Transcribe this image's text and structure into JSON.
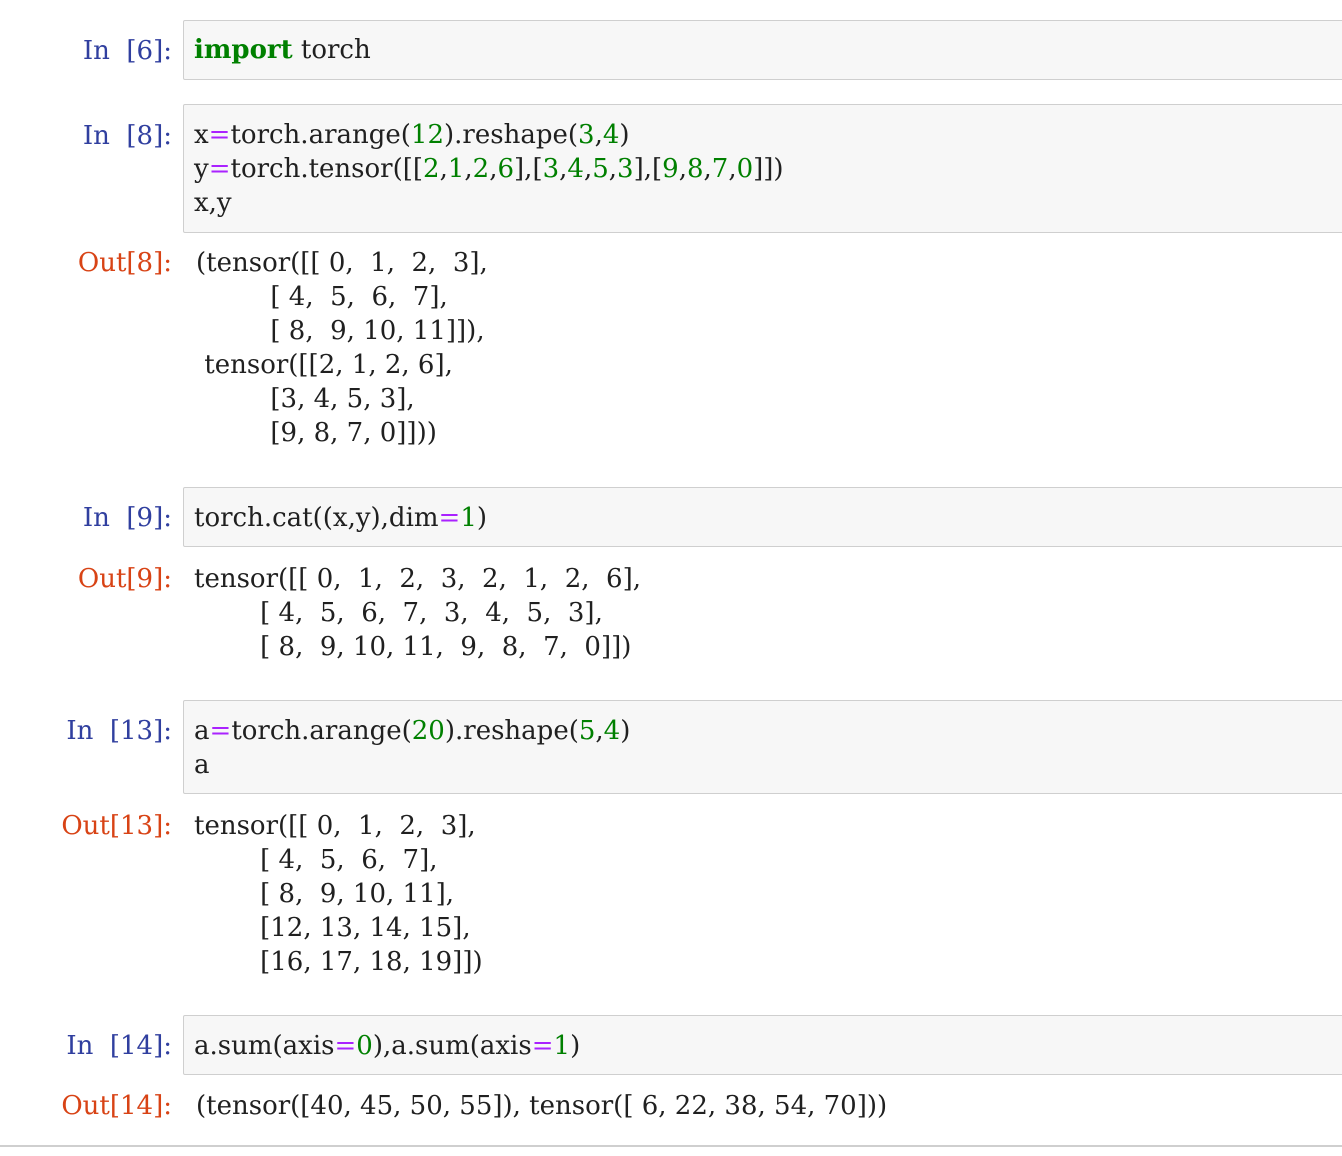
{
  "cells": [
    {
      "in_prompt": "In  [6]:",
      "code_lines": [
        [
          {
            "t": "import",
            "c": "kw"
          },
          {
            "t": " torch",
            "c": ""
          }
        ]
      ]
    },
    {
      "in_prompt": "In  [8]:",
      "code_lines": [
        [
          {
            "t": "x",
            "c": ""
          },
          {
            "t": "=",
            "c": "op"
          },
          {
            "t": "torch.arange(",
            "c": ""
          },
          {
            "t": "12",
            "c": "num"
          },
          {
            "t": ").reshape(",
            "c": ""
          },
          {
            "t": "3",
            "c": "num"
          },
          {
            "t": ",",
            "c": ""
          },
          {
            "t": "4",
            "c": "num"
          },
          {
            "t": ")",
            "c": ""
          }
        ],
        [
          {
            "t": "y",
            "c": ""
          },
          {
            "t": "=",
            "c": "op"
          },
          {
            "t": "torch.tensor([[",
            "c": ""
          },
          {
            "t": "2",
            "c": "num"
          },
          {
            "t": ",",
            "c": ""
          },
          {
            "t": "1",
            "c": "num"
          },
          {
            "t": ",",
            "c": ""
          },
          {
            "t": "2",
            "c": "num"
          },
          {
            "t": ",",
            "c": ""
          },
          {
            "t": "6",
            "c": "num"
          },
          {
            "t": "],[",
            "c": ""
          },
          {
            "t": "3",
            "c": "num"
          },
          {
            "t": ",",
            "c": ""
          },
          {
            "t": "4",
            "c": "num"
          },
          {
            "t": ",",
            "c": ""
          },
          {
            "t": "5",
            "c": "num"
          },
          {
            "t": ",",
            "c": ""
          },
          {
            "t": "3",
            "c": "num"
          },
          {
            "t": "],[",
            "c": ""
          },
          {
            "t": "9",
            "c": "num"
          },
          {
            "t": ",",
            "c": ""
          },
          {
            "t": "8",
            "c": "num"
          },
          {
            "t": ",",
            "c": ""
          },
          {
            "t": "7",
            "c": "num"
          },
          {
            "t": ",",
            "c": ""
          },
          {
            "t": "0",
            "c": "num"
          },
          {
            "t": "]])",
            "c": ""
          }
        ],
        [
          {
            "t": "x,y",
            "c": ""
          }
        ]
      ],
      "out_prompt": "Out[8]:",
      "output": "(tensor([[ 0,  1,  2,  3],\n         [ 4,  5,  6,  7],\n         [ 8,  9, 10, 11]]),\n tensor([[2, 1, 2, 6],\n         [3, 4, 5, 3],\n         [9, 8, 7, 0]]))"
    },
    {
      "in_prompt": "In  [9]:",
      "code_lines": [
        [
          {
            "t": "torch.cat((x,y),dim",
            "c": ""
          },
          {
            "t": "=",
            "c": "op"
          },
          {
            "t": "1",
            "c": "num"
          },
          {
            "t": ")",
            "c": ""
          }
        ]
      ],
      "out_prompt": "Out[9]:",
      "output": "tensor([[ 0,  1,  2,  3,  2,  1,  2,  6],\n        [ 4,  5,  6,  7,  3,  4,  5,  3],\n        [ 8,  9, 10, 11,  9,  8,  7,  0]])"
    },
    {
      "in_prompt": "In  [13]:",
      "code_lines": [
        [
          {
            "t": "a",
            "c": ""
          },
          {
            "t": "=",
            "c": "op"
          },
          {
            "t": "torch.arange(",
            "c": ""
          },
          {
            "t": "20",
            "c": "num"
          },
          {
            "t": ").reshape(",
            "c": ""
          },
          {
            "t": "5",
            "c": "num"
          },
          {
            "t": ",",
            "c": ""
          },
          {
            "t": "4",
            "c": "num"
          },
          {
            "t": ")",
            "c": ""
          }
        ],
        [
          {
            "t": "a",
            "c": ""
          }
        ]
      ],
      "out_prompt": "Out[13]:",
      "output": "tensor([[ 0,  1,  2,  3],\n        [ 4,  5,  6,  7],\n        [ 8,  9, 10, 11],\n        [12, 13, 14, 15],\n        [16, 17, 18, 19]])"
    },
    {
      "in_prompt": "In  [14]:",
      "code_lines": [
        [
          {
            "t": "a.sum(axis",
            "c": ""
          },
          {
            "t": "=",
            "c": "op"
          },
          {
            "t": "0",
            "c": "num"
          },
          {
            "t": "),a.sum(axis",
            "c": ""
          },
          {
            "t": "=",
            "c": "op"
          },
          {
            "t": "1",
            "c": "num"
          },
          {
            "t": ")",
            "c": ""
          }
        ]
      ],
      "out_prompt": "Out[14]:",
      "output": "(tensor([40, 45, 50, 55]), tensor([ 6, 22, 38, 54, 70]))"
    }
  ],
  "colors": {
    "in_prompt": "#303f9f",
    "out_prompt": "#d84315",
    "keyword": "#008000",
    "number": "#008000",
    "operator": "#aa22ff",
    "input_bg": "#f7f7f7",
    "border": "#cfcfcf"
  }
}
